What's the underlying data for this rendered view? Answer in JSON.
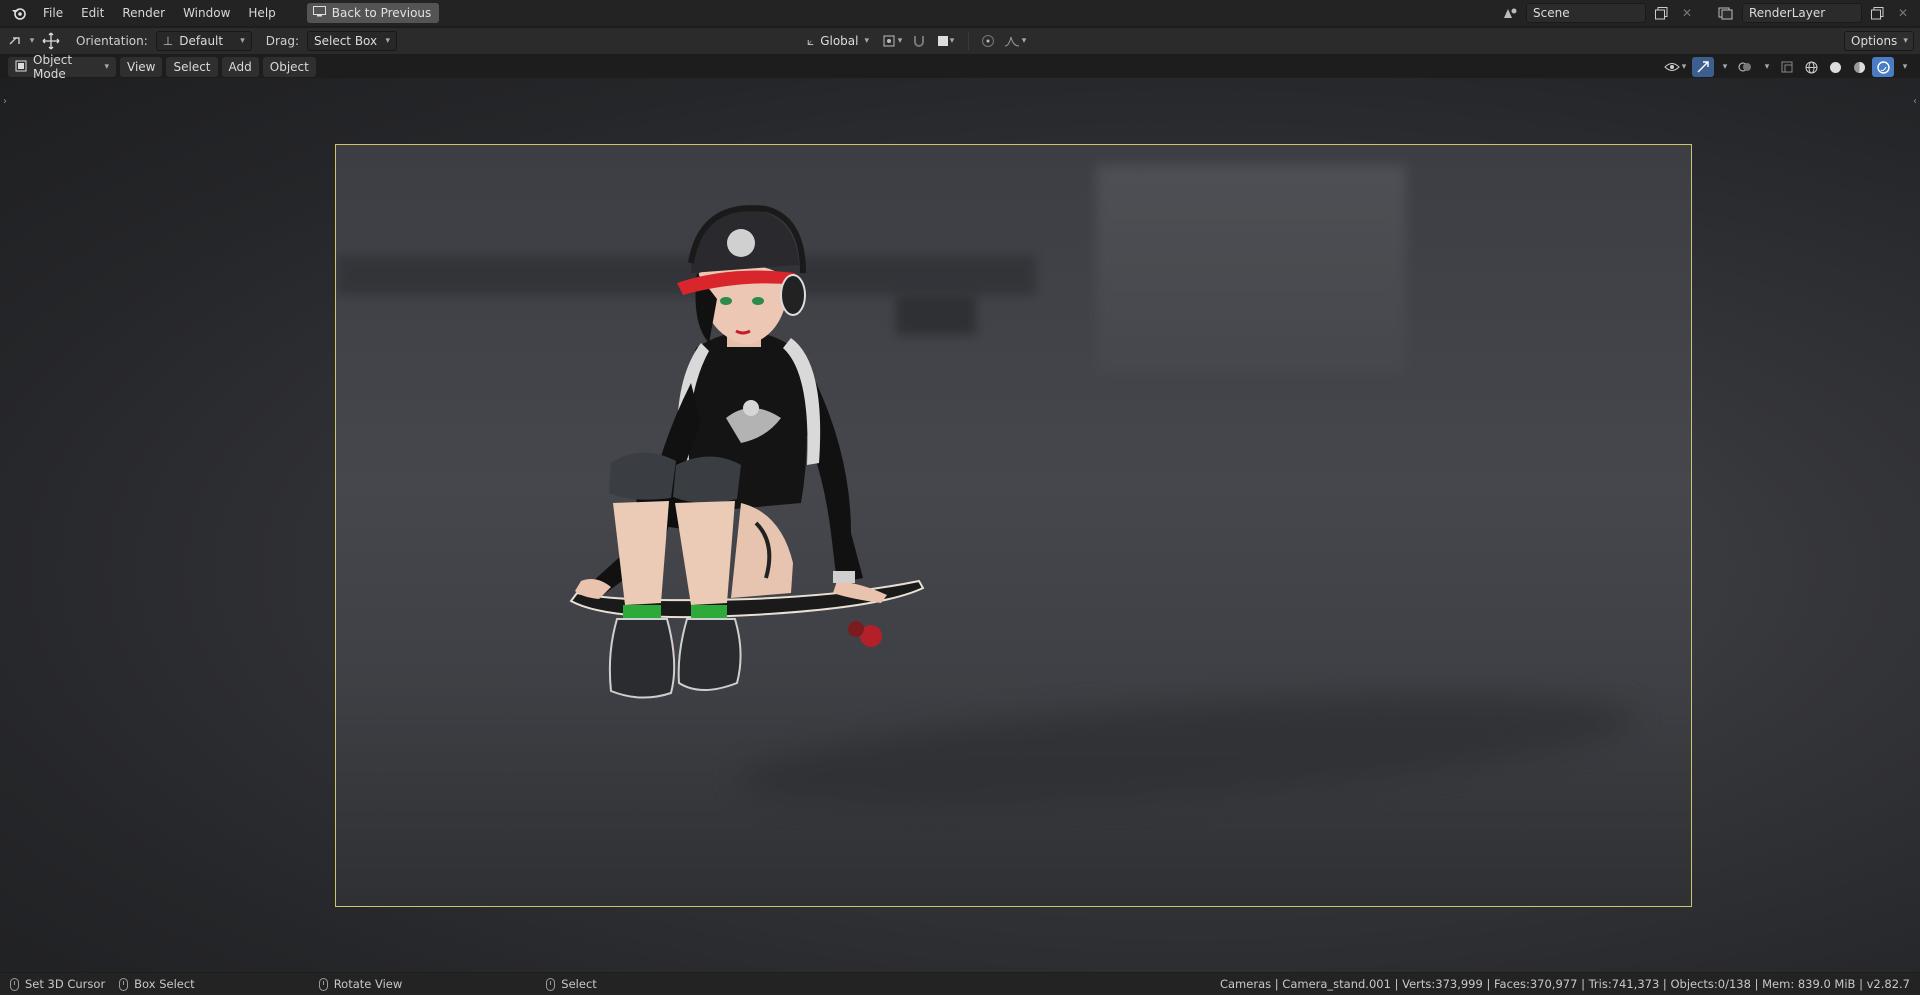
{
  "topbar": {
    "menus": [
      "File",
      "Edit",
      "Render",
      "Window",
      "Help"
    ],
    "back_button": "Back to Previous",
    "scene": "Scene",
    "render_layer": "RenderLayer"
  },
  "toolbar": {
    "orientation_label": "Orientation:",
    "orientation_value": "Default",
    "drag_label": "Drag:",
    "drag_value": "Select Box",
    "transform_orientation": "Global",
    "options_label": "Options"
  },
  "viewport_header": {
    "mode": "Object Mode",
    "menus": [
      "View",
      "Select",
      "Add",
      "Object"
    ]
  },
  "statusbar": {
    "items": [
      "Set 3D Cursor",
      "Box Select",
      "Rotate View",
      "Select"
    ],
    "stats": "Cameras | Camera_stand.001 | Verts:373,999 | Faces:370,977 | Tris:741,373 | Objects:0/138 | Mem: 839.0 MiB | v2.82.7"
  },
  "colors": {
    "camera_frame": "#c9c76a",
    "cap_visor": "#d8262c",
    "socks": "#2eaa3a",
    "active_shading": "#4a7cc4"
  }
}
